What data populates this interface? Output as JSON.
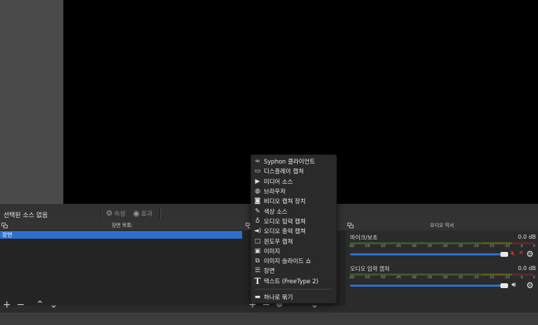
{
  "context_bar": {
    "no_source_label": "선택된 소스 없음",
    "properties_label": "속성",
    "filters_label": "효과"
  },
  "scenes": {
    "title": "장면 목록:",
    "items": [
      "장면"
    ]
  },
  "mixer": {
    "title": "오디오 믹서",
    "scale": [
      "-60",
      "-55",
      "-50",
      "-45",
      "-40",
      "-35",
      "-30",
      "-25",
      "-20",
      "-15",
      "-10",
      "-5",
      "0"
    ],
    "channels": [
      {
        "name": "마이크/보조",
        "db": "0.0 dB",
        "muted": true,
        "level": 1.0
      },
      {
        "name": "오디오 입력 캡쳐",
        "db": "0.0 dB",
        "muted": false,
        "level": 1.0
      }
    ],
    "colors": {
      "muted": "#e0393e",
      "fader": "#2d6fd0"
    }
  },
  "add_source_menu": {
    "items": [
      {
        "icon": "glasses-icon",
        "label": "Syphon 클라이언트"
      },
      {
        "icon": "monitor-icon",
        "label": "디스플레이 캡쳐"
      },
      {
        "icon": "play-icon",
        "label": "미디어 소스"
      },
      {
        "icon": "globe-icon",
        "label": "브라우저"
      },
      {
        "icon": "camera-icon",
        "label": "비디오 캡쳐 장치"
      },
      {
        "icon": "brush-icon",
        "label": "색상 소스"
      },
      {
        "icon": "microphone-icon",
        "label": "오디오 입력 캡쳐"
      },
      {
        "icon": "speaker-icon",
        "label": "오디오 출력 캡쳐"
      },
      {
        "icon": "window-icon",
        "label": "윈도우 캡쳐"
      },
      {
        "icon": "image-icon",
        "label": "이미지"
      },
      {
        "icon": "slideshow-icon",
        "label": "이미지 슬라이드 쇼"
      },
      {
        "icon": "list-icon",
        "label": "장면"
      },
      {
        "icon": "text-icon",
        "label": "텍스트 (FreeType 2)"
      }
    ],
    "group_item": {
      "icon": "folder-icon",
      "label": "하나로 묶기"
    }
  },
  "colors": {
    "accent": "#2d6fd0",
    "panel": "#2b2b2b",
    "background": "#3c3c3c"
  }
}
